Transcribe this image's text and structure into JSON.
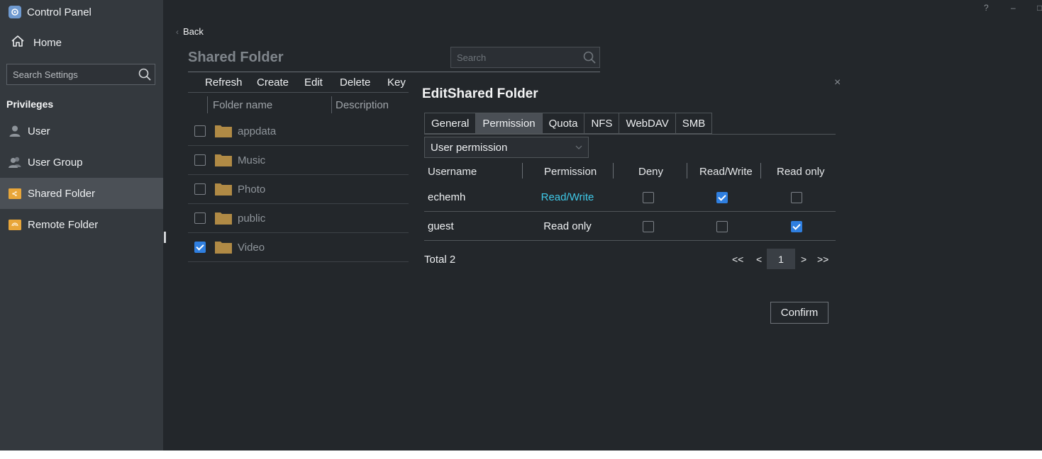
{
  "app": {
    "title": "Control Panel"
  },
  "window_controls": {
    "help": "?",
    "minimize": "–",
    "maximize": "□"
  },
  "sidebar": {
    "home_label": "Home",
    "search_placeholder": "Search Settings",
    "section_label": "Privileges",
    "items": [
      {
        "label": "User",
        "icon": "user-icon",
        "active": false
      },
      {
        "label": "User Group",
        "icon": "user-group-icon",
        "active": false
      },
      {
        "label": "Shared Folder",
        "icon": "shared-folder-icon",
        "active": true
      },
      {
        "label": "Remote Folder",
        "icon": "remote-folder-icon",
        "active": false
      }
    ]
  },
  "main": {
    "back_label": "Back",
    "page_title": "Shared Folder",
    "search_placeholder": "Search",
    "toolbar": [
      "Refresh",
      "Create",
      "Edit",
      "Delete",
      "Key"
    ],
    "columns": {
      "name": "Folder name",
      "description": "Description"
    },
    "folders": [
      {
        "name": "appdata",
        "checked": false
      },
      {
        "name": "Music",
        "checked": false
      },
      {
        "name": "Photo",
        "checked": false
      },
      {
        "name": "public",
        "checked": false
      },
      {
        "name": "Video",
        "checked": true
      }
    ]
  },
  "dialog": {
    "title": "EditShared Folder",
    "close": "×",
    "tabs": [
      {
        "label": "General",
        "active": false
      },
      {
        "label": "Permission",
        "active": true
      },
      {
        "label": "Quota",
        "active": false
      },
      {
        "label": "NFS",
        "active": false
      },
      {
        "label": "WebDAV",
        "active": false
      },
      {
        "label": "SMB",
        "active": false
      }
    ],
    "permission_type": "User permission",
    "headers": {
      "username": "Username",
      "permission": "Permission",
      "deny": "Deny",
      "read_write": "Read/Write",
      "read_only": "Read only"
    },
    "rows": [
      {
        "username": "echemh",
        "permission": "Read/Write",
        "permission_color": "#3fc9e8",
        "deny": false,
        "read_write": true,
        "read_only": false
      },
      {
        "username": "guest",
        "permission": "Read only",
        "permission_color": "#eef0f2",
        "deny": false,
        "read_write": false,
        "read_only": true
      }
    ],
    "total": "Total 2",
    "pagination": {
      "first": "<<",
      "prev": "<",
      "current": "1",
      "next": ">",
      "last": ">>"
    },
    "confirm": "Confirm"
  },
  "colors": {
    "accent": "#2f7fe0",
    "link": "#3fc9e8",
    "folder": "#b08a45"
  }
}
